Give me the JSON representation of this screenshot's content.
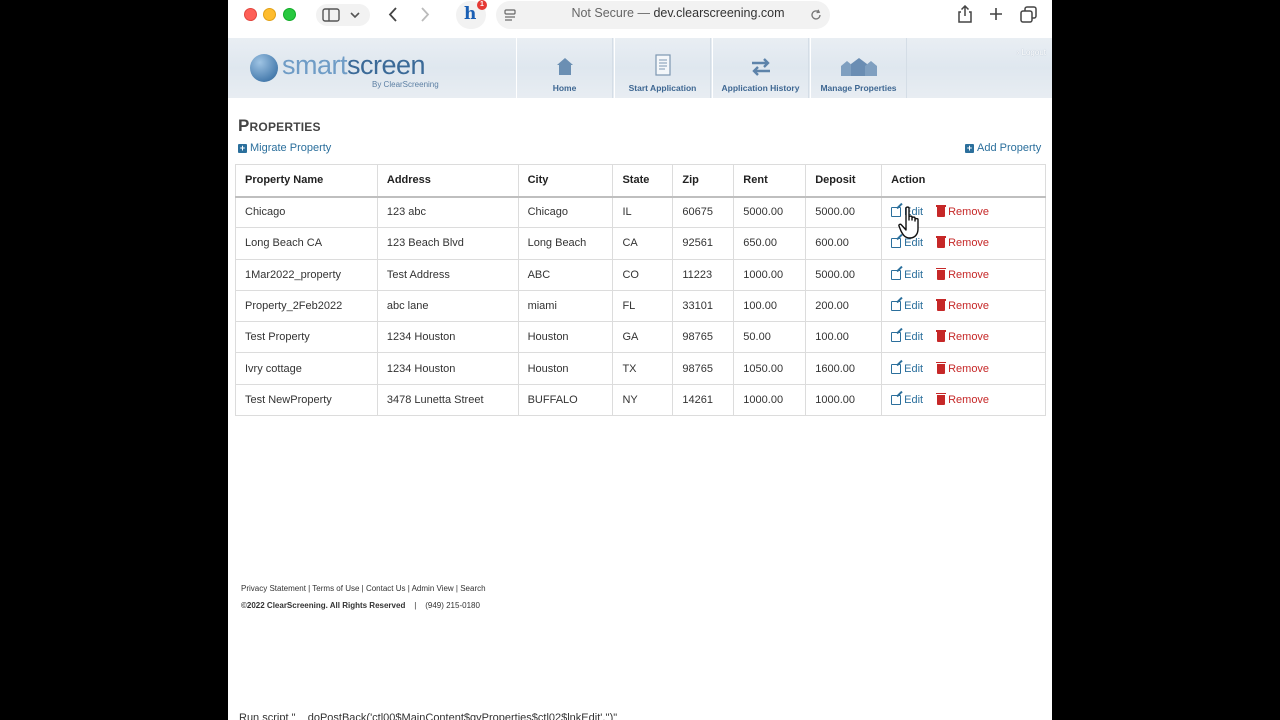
{
  "browser": {
    "security_label": "Not Secure —",
    "host": "dev.clearscreening.com",
    "extension_badge": "1"
  },
  "site": {
    "logo_text_light": "smart",
    "logo_text_bold": "screen",
    "logo_subtitle": "By ClearScreening",
    "logout": "Logout",
    "nav": [
      {
        "label": "Home",
        "icon": "house-icon"
      },
      {
        "label": "Start Application",
        "icon": "document-icon"
      },
      {
        "label": "Application History",
        "icon": "swap-arrows-icon"
      },
      {
        "label": "Manage Properties",
        "icon": "buildings-icon"
      }
    ]
  },
  "page": {
    "title": "Properties",
    "migrate_label": "Migrate Property",
    "add_label": "Add Property"
  },
  "table": {
    "headers": [
      "Property Name",
      "Address",
      "City",
      "State",
      "Zip",
      "Rent",
      "Deposit",
      "Action"
    ],
    "edit_label": "Edit",
    "remove_label": "Remove",
    "rows": [
      [
        "Chicago",
        "123 abc",
        "Chicago",
        "IL",
        "60675",
        "5000.00",
        "5000.00"
      ],
      [
        "Long Beach CA",
        "123 Beach Blvd",
        "Long Beach",
        "CA",
        "92561",
        "650.00",
        "600.00"
      ],
      [
        "1Mar2022_property",
        "Test Address",
        "ABC",
        "CO",
        "11223",
        "1000.00",
        "5000.00"
      ],
      [
        "Property_2Feb2022",
        "abc lane",
        "miami",
        "FL",
        "33101",
        "100.00",
        "200.00"
      ],
      [
        "Test Property",
        "1234 Houston",
        "Houston",
        "GA",
        "98765",
        "50.00",
        "100.00"
      ],
      [
        "Ivry cottage",
        "1234 Houston",
        "Houston",
        "TX",
        "98765",
        "1050.00",
        "1600.00"
      ],
      [
        "Test NewProperty",
        "3478 Lunetta Street",
        "BUFFALO",
        "NY",
        "14261",
        "1000.00",
        "1000.00"
      ]
    ]
  },
  "footer": {
    "links": "Privacy Statement | Terms of Use | Contact Us | Admin View  | Search",
    "copyright": "©2022 ClearScreening. All Rights Reserved",
    "separator": "|",
    "phone": "(949) 215-0180"
  },
  "status_bar": "Run script \"__doPostBack('ctl00$MainContent$gvProperties$ctl02$lnkEdit','')\""
}
